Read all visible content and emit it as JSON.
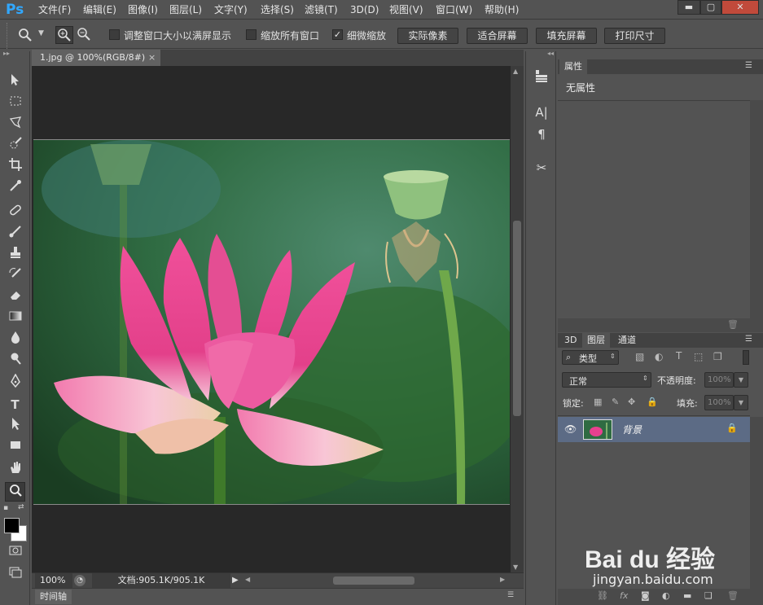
{
  "app": {
    "logo": "Ps"
  },
  "menu": [
    "文件(F)",
    "编辑(E)",
    "图像(I)",
    "图层(L)",
    "文字(Y)",
    "选择(S)",
    "滤镜(T)",
    "3D(D)",
    "视图(V)",
    "窗口(W)",
    "帮助(H)"
  ],
  "window_controls": {
    "minimize": "▬",
    "maximize": "▢",
    "close": "✕"
  },
  "options": {
    "resize_windows": {
      "label": "调整窗口大小以满屏显示",
      "checked": false
    },
    "zoom_all_windows": {
      "label": "缩放所有窗口",
      "checked": false
    },
    "scrubby_zoom": {
      "label": "细微缩放",
      "checked": true
    },
    "buttons": [
      "实际像素",
      "适合屏幕",
      "填充屏幕",
      "打印尺寸"
    ]
  },
  "document": {
    "tab_title": "1.jpg @ 100%(RGB/8#)",
    "close": "×"
  },
  "status": {
    "zoom": "100%",
    "doc_info": "文档:905.1K/905.1K"
  },
  "timeline": {
    "label": "时间轴"
  },
  "properties": {
    "tab": "属性",
    "content": "无属性"
  },
  "layers_panel": {
    "tabs": [
      "3D",
      "图层",
      "通道"
    ],
    "filter_kind": "类型",
    "blend_mode": "正常",
    "opacity_label": "不透明度:",
    "opacity_value": "100%",
    "lock_label": "锁定:",
    "fill_label": "填充:",
    "fill_value": "100%",
    "layers": [
      {
        "name": "背景",
        "visible": true,
        "locked": true
      }
    ]
  },
  "watermark": {
    "brand": "Bai du 经验",
    "url": "jingyan.baidu.com"
  },
  "colors": {
    "accent": "#31a8ff",
    "selected_layer": "#5c6b85",
    "lotus": "#e8408f"
  }
}
